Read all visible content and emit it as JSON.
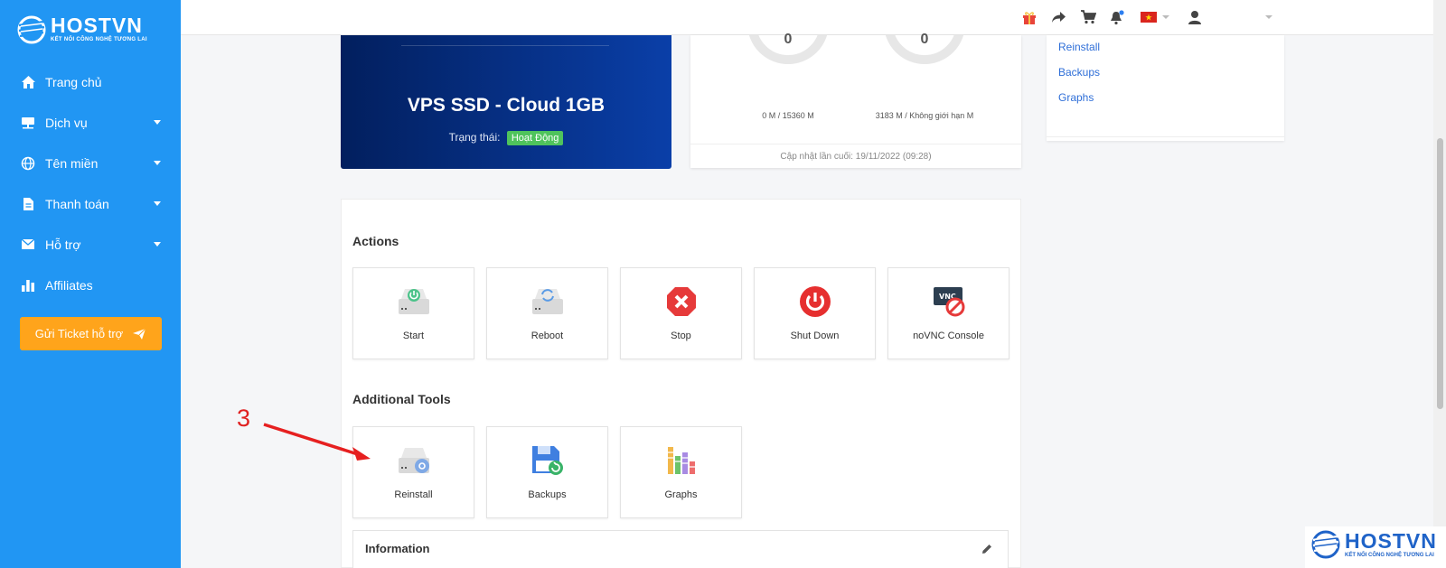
{
  "brand": {
    "name": "HOSTVN",
    "slogan": "KẾT NỐI CÔNG NGHỆ TƯƠNG LAI"
  },
  "sidebar": {
    "items": [
      {
        "label": "Trang chủ",
        "icon": "home-icon"
      },
      {
        "label": "Dịch vụ",
        "icon": "server-icon"
      },
      {
        "label": "Tên miền",
        "icon": "globe-icon"
      },
      {
        "label": "Thanh toán",
        "icon": "document-icon"
      },
      {
        "label": "Hỗ trợ",
        "icon": "envelope-icon"
      },
      {
        "label": "Affiliates",
        "icon": "bar-chart-icon"
      }
    ],
    "ticket_button": "Gửi Ticket hỗ trợ"
  },
  "hero": {
    "title": "VPS SSD - Cloud 1GB",
    "status_label": "Trạng thái:",
    "status_value": "Hoạt Động"
  },
  "usage": {
    "gauges": [
      {
        "value": "0",
        "caption": "0 M / 15360 M"
      },
      {
        "value": "0",
        "caption": "3183 M / Không giới hạn M"
      }
    ],
    "updated": "Cập nhật lần cuối: 19/11/2022 (09:28)"
  },
  "side_links": [
    "Reinstall",
    "Backups",
    "Graphs"
  ],
  "actions": {
    "title": "Actions",
    "items": [
      {
        "label": "Start",
        "icon": "start-server-icon"
      },
      {
        "label": "Reboot",
        "icon": "reboot-server-icon"
      },
      {
        "label": "Stop",
        "icon": "stop-icon"
      },
      {
        "label": "Shut Down",
        "icon": "power-icon"
      },
      {
        "label": "noVNC Console",
        "icon": "vnc-console-icon"
      }
    ]
  },
  "tools": {
    "title": "Additional Tools",
    "items": [
      {
        "label": "Reinstall",
        "icon": "reinstall-icon"
      },
      {
        "label": "Backups",
        "icon": "backup-icon"
      },
      {
        "label": "Graphs",
        "icon": "graphs-icon"
      }
    ]
  },
  "information": {
    "title": "Information"
  },
  "annotation": {
    "number": "3"
  },
  "colors": {
    "sidebar": "#2196f3",
    "accent": "#ffa41b",
    "status_badge": "#4fc35c",
    "link": "#2f6fd8"
  }
}
